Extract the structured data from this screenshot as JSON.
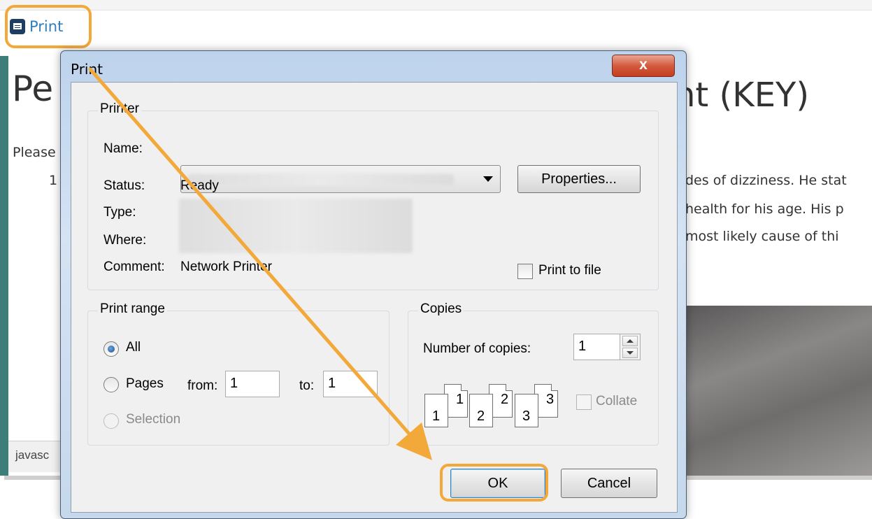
{
  "page": {
    "print_link_label": "Print",
    "title_left": "Pe",
    "title_right": "nt (KEY)",
    "intro_fragment": "Please",
    "item_number_fragment": "1",
    "text_lines_right": [
      "des of dizziness. He stat",
      "health for his age. His p",
      "most likely cause of thi"
    ],
    "status_fragment": "javasc"
  },
  "dialog": {
    "title": "Print",
    "close_label": "x",
    "printer_group": {
      "legend": "Printer",
      "name_label": "Name:",
      "properties_button": "Properties...",
      "status_label": "Status:",
      "status_value": "Ready",
      "type_label": "Type:",
      "where_label": "Where:",
      "comment_label": "Comment:",
      "comment_value": "Network Printer",
      "print_to_file_label": "Print to file"
    },
    "range_group": {
      "legend": "Print range",
      "all_label": "All",
      "pages_label": "Pages",
      "from_label": "from:",
      "from_value": "1",
      "to_label": "to:",
      "to_value": "1",
      "selection_label": "Selection"
    },
    "copies_group": {
      "legend": "Copies",
      "number_label": "Number of copies:",
      "number_value": "1",
      "collate_label": "Collate",
      "page_icons": [
        "1",
        "1",
        "2",
        "2",
        "3",
        "3"
      ]
    },
    "ok_button": "OK",
    "cancel_button": "Cancel"
  },
  "colors": {
    "highlight": "#f3a93a",
    "link": "#2e7fc2",
    "titlebar": "#c7d9ee",
    "close": "#c94a2c"
  }
}
